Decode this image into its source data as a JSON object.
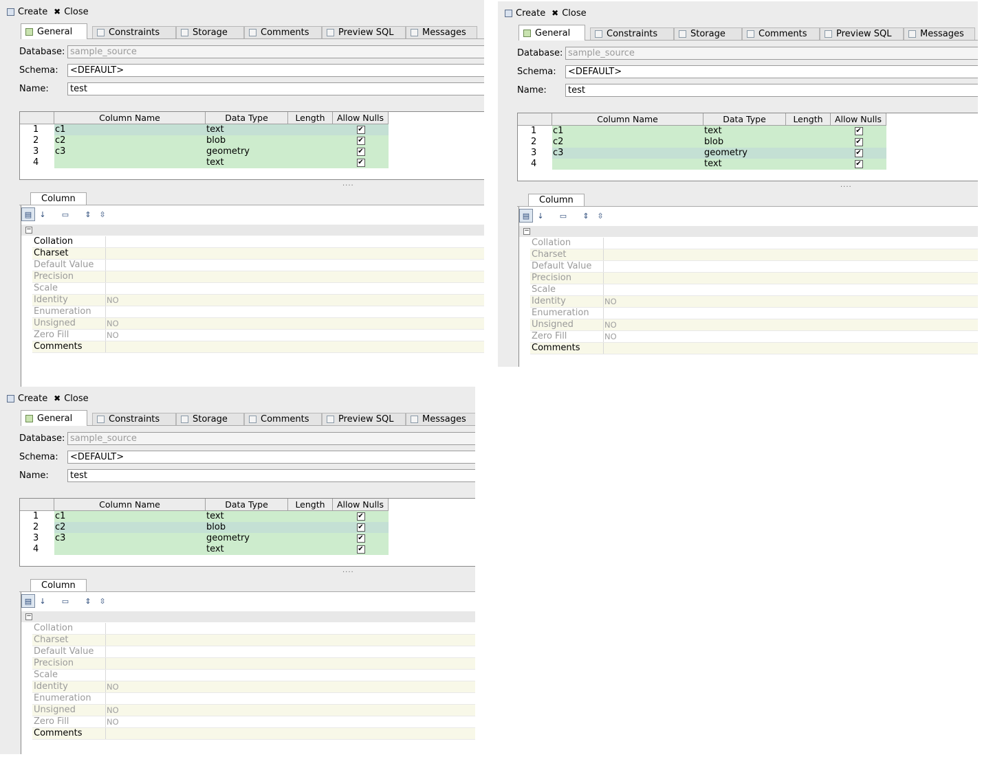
{
  "toolbar": {
    "create": "Create",
    "close": "Close"
  },
  "tabs": [
    "General",
    "Constraints",
    "Storage",
    "Comments",
    "Preview SQL",
    "Messages"
  ],
  "form": {
    "database_label": "Database:",
    "database_value": "sample_source",
    "schema_label": "Schema:",
    "schema_value": "<DEFAULT>",
    "name_label": "Name:",
    "name_value": "test"
  },
  "grid": {
    "headers": [
      "Column Name",
      "Data Type",
      "Length",
      "Allow Nulls"
    ],
    "rows": [
      {
        "num": "1",
        "name": "c1",
        "type": "text"
      },
      {
        "num": "2",
        "name": "c2",
        "type": "blob"
      },
      {
        "num": "3",
        "name": "c3",
        "type": "geometry"
      },
      {
        "num": "4",
        "name": "",
        "type": "text"
      }
    ],
    "splitter": "....",
    "check_mark": "✔"
  },
  "column_tab": "Column",
  "properties": [
    {
      "name": "Collation",
      "value": ""
    },
    {
      "name": "Charset",
      "value": ""
    },
    {
      "name": "Default Value",
      "value": ""
    },
    {
      "name": "Precision",
      "value": ""
    },
    {
      "name": "Scale",
      "value": ""
    },
    {
      "name": "Identity",
      "value": "NO"
    },
    {
      "name": "Enumeration",
      "value": ""
    },
    {
      "name": "Unsigned",
      "value": "NO"
    },
    {
      "name": "Zero Fill",
      "value": "NO"
    },
    {
      "name": "Comments",
      "value": ""
    }
  ],
  "panels": [
    {
      "selected_row": 0,
      "enabled_props": [
        "Collation",
        "Charset",
        "Comments"
      ]
    },
    {
      "selected_row": 2,
      "enabled_props": [
        "Comments"
      ]
    },
    {
      "selected_row": 1,
      "enabled_props": [
        "Comments"
      ]
    }
  ]
}
